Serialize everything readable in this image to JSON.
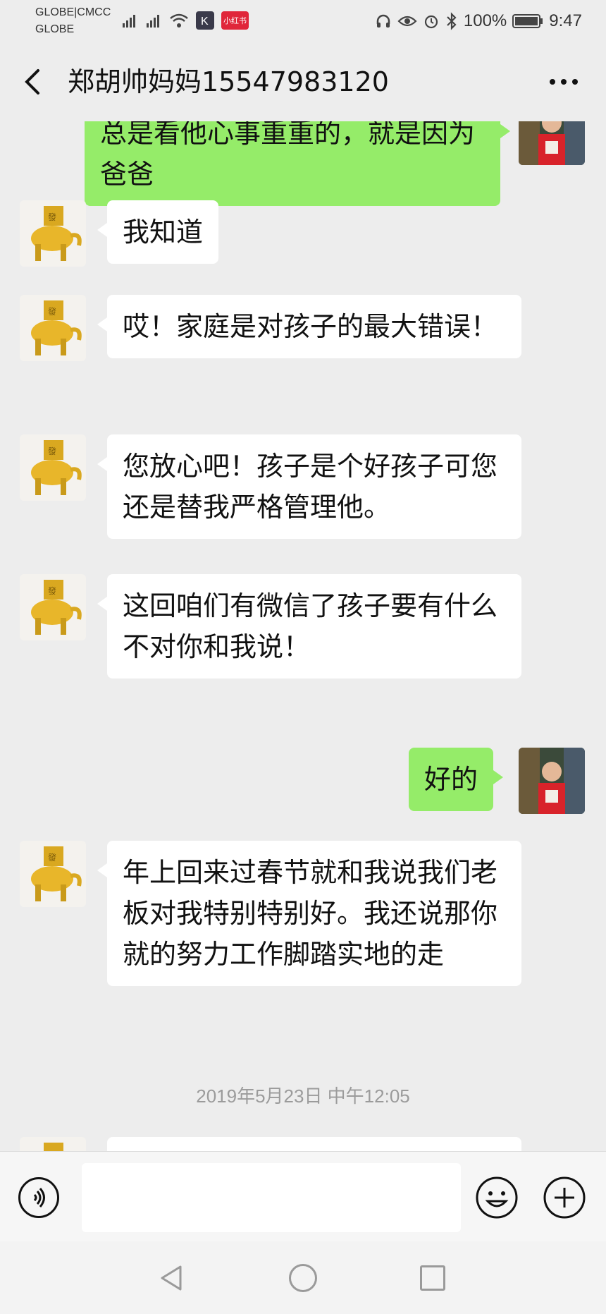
{
  "status_bar": {
    "carrier_line1": "GLOBE|CMCC",
    "carrier_line2": "GLOBE",
    "app_badge": "小红书",
    "battery": "100%",
    "time": "9:47"
  },
  "header": {
    "title": "郑胡帅妈妈15547983120"
  },
  "messages": [
    {
      "side": "out",
      "text": "总是看他心事重重的，就是因为爸爸"
    },
    {
      "side": "in",
      "text": "我知道"
    },
    {
      "side": "in",
      "text": "哎！家庭是对孩子的最大错误！"
    },
    {
      "side": "in",
      "text": "您放心吧！孩子是个好孩子可您还是替我严格管理他。"
    },
    {
      "side": "in",
      "text": "这回咱们有微信了孩子要有什么不对你和我说！"
    },
    {
      "side": "out",
      "text": "好的"
    },
    {
      "side": "in",
      "text": "年上回来过春节就和我说我们老板对我特别特别好。我还说那你就的努力工作脚踏实地的走"
    }
  ],
  "timestamp": "2019年5月23日 中午12:05",
  "colors": {
    "background": "#ededed",
    "outgoing_bubble": "#95ec69",
    "incoming_bubble": "#ffffff"
  },
  "icons": [
    "voice-icon",
    "emoji-icon",
    "plus-icon",
    "back-arrow-icon",
    "more-icon"
  ]
}
